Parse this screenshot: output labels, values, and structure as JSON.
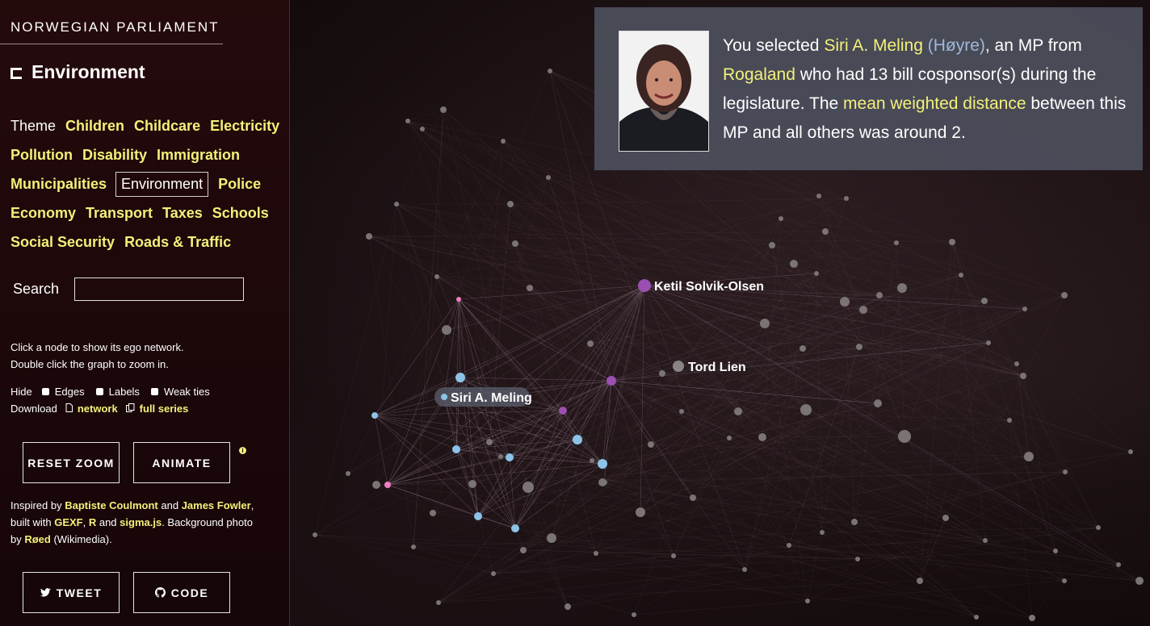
{
  "site": {
    "title": "NORWEGIAN PARLIAMENT"
  },
  "current": {
    "title": "Environment"
  },
  "themes": {
    "label": "Theme",
    "row1": [
      "Children",
      "Childcare",
      "Electricity"
    ],
    "row2": [
      "Pollution",
      "Disability",
      "Immigration"
    ],
    "row3_before": [
      "Municipalities"
    ],
    "row3_active": "Environment",
    "row3_after": [
      "Police"
    ],
    "row4": [
      "Economy",
      "Transport",
      "Taxes",
      "Schools"
    ],
    "row5": [
      "Social Security",
      "Roads & Traffic"
    ]
  },
  "search": {
    "label": "Search",
    "value": "",
    "placeholder": ""
  },
  "help": {
    "line1": "Click a node to show its ego network.",
    "line2": "Double click the graph to zoom in."
  },
  "toggles": {
    "label": "Hide",
    "edges": "Edges",
    "labels": "Labels",
    "weak": "Weak ties"
  },
  "download": {
    "label": "Download",
    "network": "network",
    "full_series": "full series"
  },
  "buttons": {
    "reset_zoom": "RESET ZOOM",
    "animate": "ANIMATE",
    "tweet": "TWEET",
    "code": "CODE",
    "info": "i"
  },
  "credits": {
    "t1": "Inspired by ",
    "l1": "Baptiste Coulmont",
    "t2": " and ",
    "l2": "James Fowler",
    "t3": ",",
    "t4": "built with ",
    "l3": "GEXF",
    "t5": ", ",
    "l4": "R",
    "t6": " and ",
    "l5": "sigma.js",
    "t7": ". Background photo",
    "t8": "by ",
    "l6": "Røed",
    "t9": " (Wikimedia)."
  },
  "panel": {
    "p1": "You selected ",
    "name": "Siri A. Meling",
    "party": "(Høyre)",
    "p2": ", an MP from",
    "region": "Rogaland",
    "p3": " who had 13 bill cosponsor(s) during the legislature. The ",
    "metric": "mean weighted distance",
    "p4": " between this MP and all others was around 2."
  },
  "graph_labels": {
    "selected": "Siri A. Meling",
    "a": "Ketil Solvik-Olsen",
    "b": "Tord Lien"
  },
  "colors": {
    "accent": "#f3f07a",
    "node_default": "#7a7474",
    "node_blue": "#8cc3e8",
    "node_purple": "#9b4fb0",
    "node_pink": "#f07fbf"
  }
}
